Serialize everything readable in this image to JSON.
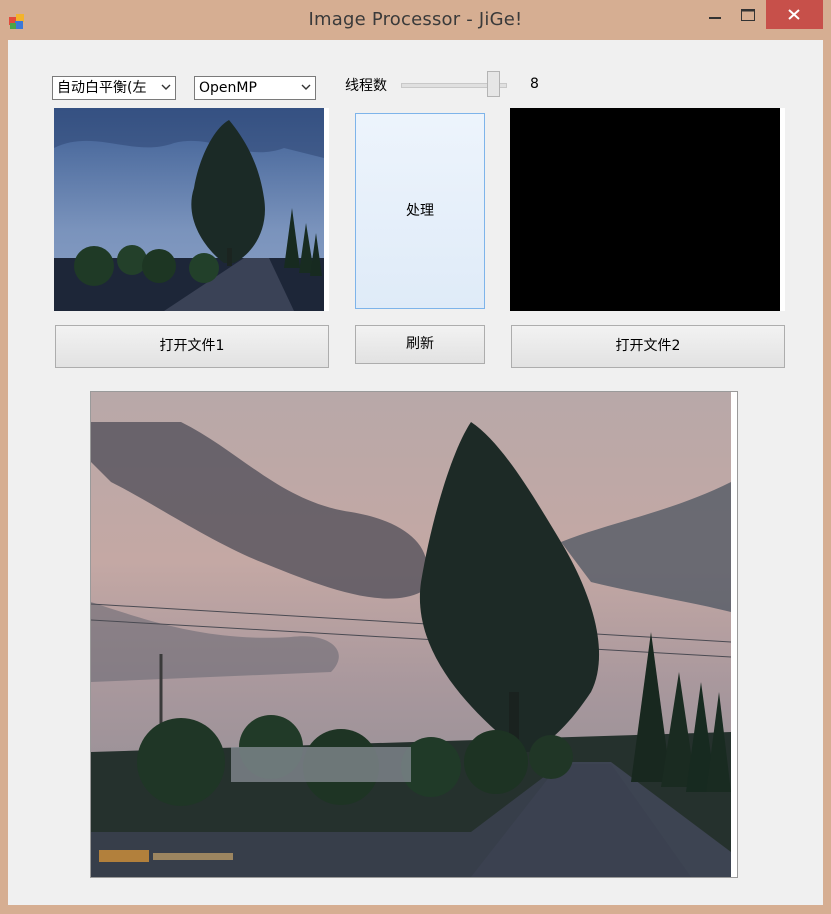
{
  "window": {
    "title": "Image Processor - JiGe!"
  },
  "toolbar": {
    "algorithm_select": "自动白平衡(左",
    "backend_select": "OpenMP",
    "threads_label": "线程数",
    "threads_value": "8",
    "threads_slider_fraction": 0.95
  },
  "buttons": {
    "process": "处理",
    "open_file_1": "打开文件1",
    "refresh": "刷新",
    "open_file_2": "打开文件2"
  },
  "colors": {
    "window_frame": "#d6ae92",
    "close_button": "#c7504a",
    "client_bg": "#f0f0f0",
    "process_button": "#e6eef9",
    "output_box": "#000000"
  },
  "images": {
    "source_thumbnail_icon": "landscape-photo-tree-blue",
    "output_thumbnail": "black",
    "result_image_icon": "landscape-photo-tree-pink-sky"
  }
}
